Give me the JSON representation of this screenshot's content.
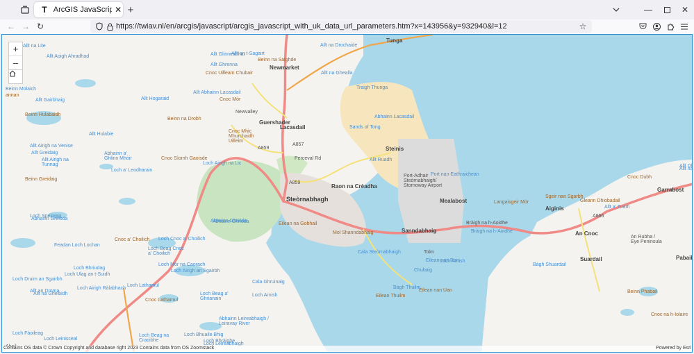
{
  "browser": {
    "tab_title": "ArcGIS JavaScript with UK data",
    "tab_favicon": "T",
    "url": "https://twiav.nl/en/arcgis/javascript/arcgis_javascript_with_uk_data_url_parameters.htm?x=143956&y=932940&l=12"
  },
  "map": {
    "zoom_in": "+",
    "zoom_out": "–",
    "attribution": "Contains OS data © Crown Copyright and database right 2023 Contains data from OS Zoomstack",
    "powered_by": "Powered by Esri",
    "labels": [
      {
        "t": "Tunga",
        "c": "place-md"
      },
      {
        "t": "Newmarket",
        "c": "place-md"
      },
      {
        "t": "Guershader",
        "c": "place-md"
      },
      {
        "t": "Lacasdail",
        "c": "place-md"
      },
      {
        "t": "Steòrnabhagh",
        "c": "place-lg"
      },
      {
        "t": "Raon na Crèadha",
        "c": "place-md"
      },
      {
        "t": "Steinis",
        "c": "place-md"
      },
      {
        "t": "Port-Adhair\nSteòrnabhaigh/\nStornoway Airport",
        "c": "place-sm"
      },
      {
        "t": "Mealabost",
        "c": "place-md"
      },
      {
        "t": "Sanndabhaig",
        "c": "place-md"
      },
      {
        "t": "Aiginis",
        "c": "place-md"
      },
      {
        "t": "An Cnoc",
        "c": "place-md"
      },
      {
        "t": "Suardail",
        "c": "place-md"
      },
      {
        "t": "Garrabost",
        "c": "place-md"
      },
      {
        "t": "Pabail",
        "c": "place-md"
      },
      {
        "t": "An Rubha /\nEye Peninsula",
        "c": "place-sm"
      },
      {
        "t": "Tolm",
        "c": "place-sm"
      },
      {
        "t": "Newvalley",
        "c": "place-sm"
      },
      {
        "t": "Beinn na Saighde",
        "c": "terrain"
      },
      {
        "t": "Cnoc Uilleam Chubair",
        "c": "terrain"
      },
      {
        "t": "Cnoc Mòr",
        "c": "terrain"
      },
      {
        "t": "Beinn na Drobh",
        "c": "terrain"
      },
      {
        "t": "Cnoc Mhic\nMhurchaidh\nUilleim",
        "c": "terrain"
      },
      {
        "t": "Cnoc Sìomh Gaoisde",
        "c": "terrain"
      },
      {
        "t": "Beinn Hulabaidh",
        "c": "terrain"
      },
      {
        "t": "Cnoc a' Choilich",
        "c": "terrain"
      },
      {
        "t": "Cnoc Lathamul",
        "c": "terrain"
      },
      {
        "t": "Beinn Phabail",
        "c": "terrain"
      },
      {
        "t": "Cnoc Dubh",
        "c": "terrain"
      },
      {
        "t": "Cnoc na h-Iolaire",
        "c": "terrain"
      },
      {
        "t": "Beinn Greidaig",
        "c": "terrain"
      },
      {
        "t": "Sgeir nan Sgarbh",
        "c": "terrain"
      },
      {
        "t": "Gleann Dhiobadail",
        "c": "terrain"
      },
      {
        "t": "Eilean na Gobhail",
        "c": "terrain"
      },
      {
        "t": "Eilean Thuilm",
        "c": "terrain"
      },
      {
        "t": "Eilean nan Uan",
        "c": "terrain"
      },
      {
        "t": "Langaisgeir Mòr",
        "c": "terrain"
      },
      {
        "t": "Mol Shanndabhaig",
        "c": "terrain"
      },
      {
        "t": "Traigh Thunga",
        "c": "water"
      },
      {
        "t": "Sands of Tong",
        "c": "water"
      },
      {
        "t": "Abhainn Lacasdail",
        "c": "water"
      },
      {
        "t": "Port nan Eathraichean",
        "c": "water"
      },
      {
        "t": "Bràigh na h-Aoidhe",
        "c": "road"
      },
      {
        "t": "Bràigh na h-Aoidhe",
        "c": "water"
      },
      {
        "t": "Cala Steòrnabhaigh",
        "c": "water"
      },
      {
        "t": "Loch Arnish",
        "c": "water"
      },
      {
        "t": "Abhainn Leireabhaigh /\nLeiravay River",
        "c": "water"
      },
      {
        "t": "Loch Leireabhaigh",
        "c": "water"
      },
      {
        "t": "Loch Bhràighe",
        "c": "water"
      },
      {
        "t": "Loch Bhriudag",
        "c": "water"
      },
      {
        "t": "Loch Mòr na Caorach",
        "c": "water"
      },
      {
        "t": "Loch Airigh an Sgairbh",
        "c": "water"
      },
      {
        "t": "Loch Airigh Ràlabhach",
        "c": "water"
      },
      {
        "t": "Feadan Loch Lochan",
        "c": "water"
      },
      {
        "t": "Loch Speireag",
        "c": "water"
      },
      {
        "t": "Abhainn Ghriòda",
        "c": "water"
      },
      {
        "t": "Abhainn Ghriòda",
        "c": "water"
      },
      {
        "t": "Loch a' Leodharain",
        "c": "water"
      },
      {
        "t": "Allt Greidaig",
        "c": "water"
      },
      {
        "t": "Allt Airigh na Venise",
        "c": "water"
      },
      {
        "t": "Allt Hulabie",
        "c": "water"
      },
      {
        "t": "Allt Gairbhaig",
        "c": "water"
      },
      {
        "t": "Allt Hogaraid",
        "c": "water"
      },
      {
        "t": "Allt Abhainn Lacasdail",
        "c": "water"
      },
      {
        "t": "Loch Druim an Sgairbh",
        "c": "water"
      },
      {
        "t": "Loch Fàoileag",
        "c": "water"
      },
      {
        "t": "Allt na Drochaide",
        "c": "water"
      },
      {
        "t": "Allt na Lite",
        "c": "water"
      },
      {
        "t": "Allt Aoigh Ahradhad",
        "c": "water"
      },
      {
        "t": "Allt an t-Sagairt",
        "c": "water"
      },
      {
        "t": "Allt na Ghealla",
        "c": "water"
      },
      {
        "t": "Allt Ruadh",
        "c": "water"
      },
      {
        "t": "Allt a' Tuath",
        "c": "water"
      },
      {
        "t": "Allt Dhubh",
        "c": "water"
      },
      {
        "t": "Bàgh Thuilm",
        "c": "water"
      },
      {
        "t": "Bàgh Shuardail",
        "c": "water"
      },
      {
        "t": "Chubaig",
        "c": "water"
      },
      {
        "t": "Loch Airigh na Lic",
        "c": "water"
      },
      {
        "t": "Loch Cnoc a' Choilich",
        "c": "water"
      },
      {
        "t": "Loch Beag Cnoc\na' Choilich",
        "c": "water"
      },
      {
        "t": "Loch Lathamul",
        "c": "water"
      },
      {
        "t": "Loch Beag a'\nGhrianain",
        "c": "water"
      },
      {
        "t": "Cala Ghruinaig",
        "c": "water"
      },
      {
        "t": "Beinn Molaich",
        "c": "water"
      },
      {
        "t": "Allt Glinneabhat",
        "c": "water"
      },
      {
        "t": "Loch Leinisceal",
        "c": "water"
      },
      {
        "t": "Loch Beag na\nCraoibhe",
        "c": "water"
      },
      {
        "t": "Loch Bhuaile Bhig",
        "c": "water"
      },
      {
        "t": "Allt Ghrenna",
        "c": "water"
      },
      {
        "t": "Loch Ulag an t-Suidh",
        "c": "water"
      },
      {
        "t": "Allt na Gheibidh",
        "c": "water"
      },
      {
        "t": "A859",
        "c": "road"
      },
      {
        "t": "A866",
        "c": "road"
      },
      {
        "t": "A857",
        "c": "road"
      },
      {
        "t": "A859",
        "c": "road"
      },
      {
        "t": "Perceval Rd",
        "c": "road"
      },
      {
        "t": "Abhainn a'\nGhlinn Mhòir",
        "c": "water"
      },
      {
        "t": "Allt nan Con",
        "c": "water"
      },
      {
        "t": "Allt Airigh na\nTunnag",
        "c": "water"
      },
      {
        "t": "Loch Arnish",
        "c": "water"
      },
      {
        "t": "Eilean nan Ron",
        "c": "water"
      },
      {
        "t": "Abhainn Ghriòda",
        "c": "water"
      },
      {
        "t": "Abail",
        "c": "place-sm"
      },
      {
        "t": "annan",
        "c": "terrain"
      },
      {
        "t": "Allt an Droma",
        "c": "water"
      }
    ]
  }
}
